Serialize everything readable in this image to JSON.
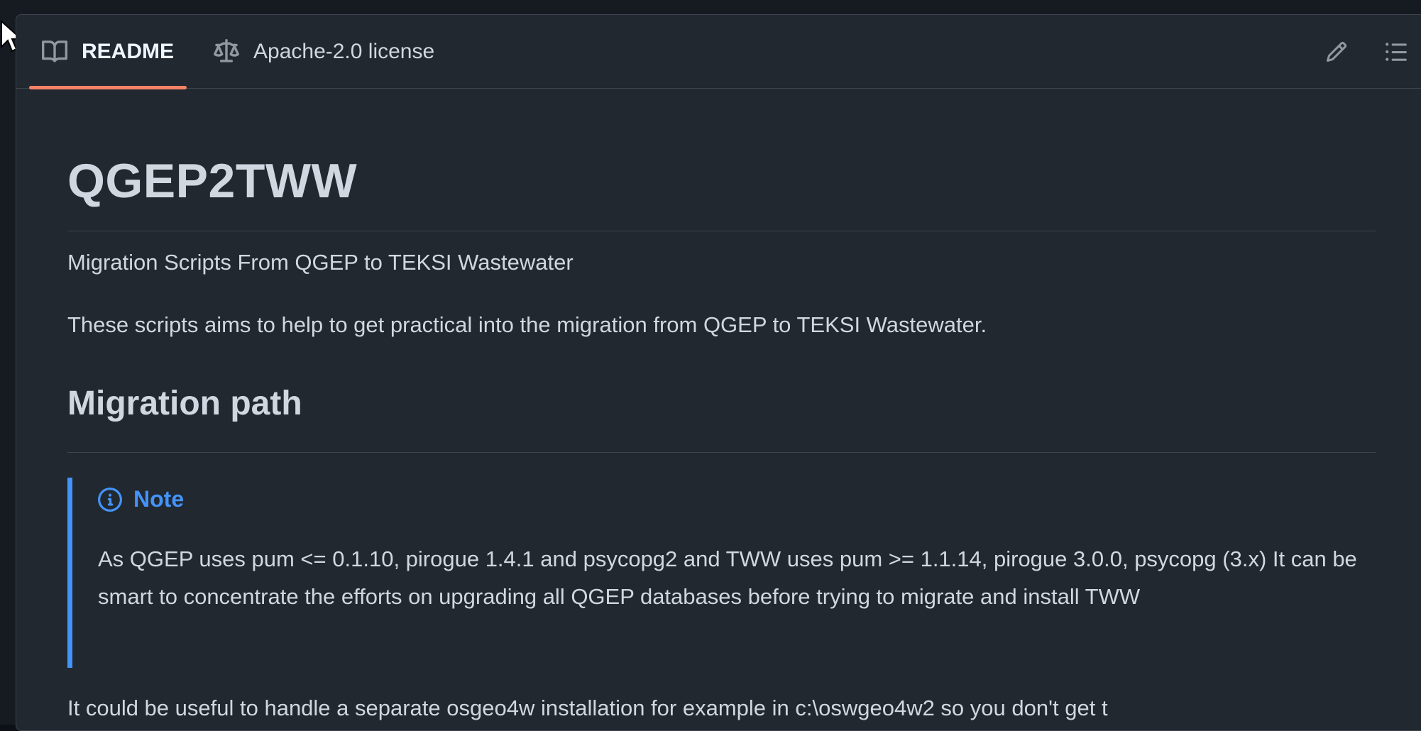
{
  "tabs": {
    "readme_label": "README",
    "license_label": "Apache-2.0 license"
  },
  "icons": {
    "readme": "book-icon",
    "license": "law-scale-icon",
    "edit": "pencil-icon",
    "outline": "list-unordered-icon",
    "note": "info-icon"
  },
  "readme": {
    "title": "QGEP2TWW",
    "subtitle": "Migration Scripts From QGEP to TEKSI Wastewater",
    "intro": "These scripts aims to help to get practical into the migration from QGEP to TEKSI Wastewater.",
    "section_heading": "Migration path",
    "note_label": "Note",
    "note_text": "As QGEP uses pum <= 0.1.10, pirogue 1.4.1 and psycopg2 and TWW uses pum >= 1.1.14, pirogue 3.0.0, psycopg (3.x) It can be smart to concentrate the efforts on upgrading all QGEP databases before trying to migrate and install TWW",
    "trailing_text": "It could be useful to handle a separate osgeo4w installation for example in c:\\oswgeo4w2 so you don't get t"
  },
  "colors": {
    "background": "#212830",
    "border": "#3d444d",
    "text": "#d1d7e0",
    "muted": "#9198a1",
    "accent_tab": "#f78166",
    "note_blue": "#4493f8"
  }
}
